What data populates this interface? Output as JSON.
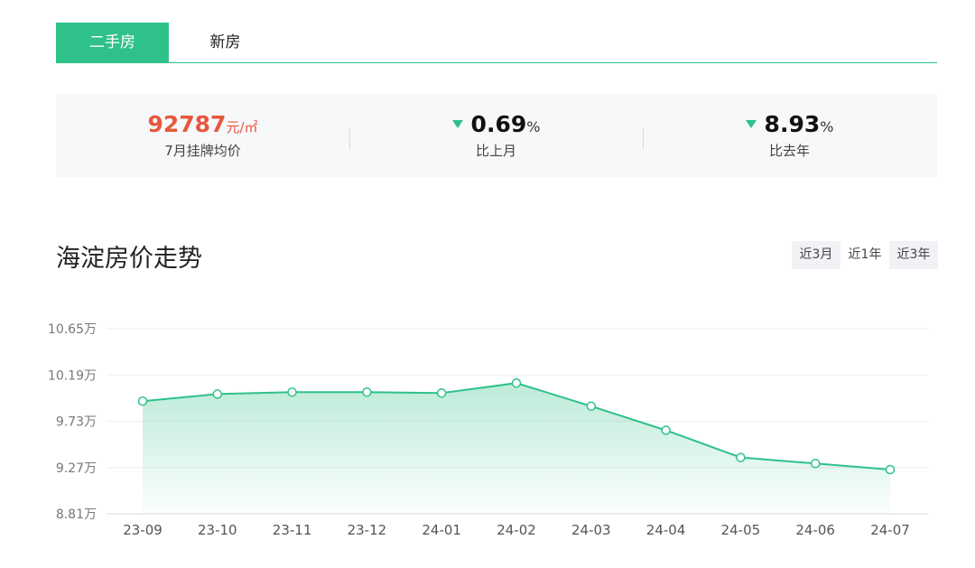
{
  "tabs": [
    {
      "label": "二手房",
      "active": true
    },
    {
      "label": "新房",
      "active": false
    }
  ],
  "stats": {
    "price": {
      "value": "92787",
      "unit": "元/㎡",
      "label": "7月挂牌均价"
    },
    "mom": {
      "value": "0.69",
      "unit": "%",
      "label": "比上月",
      "direction": "down"
    },
    "yoy": {
      "value": "8.93",
      "unit": "%",
      "label": "比去年",
      "direction": "down"
    }
  },
  "section_title": "海淀房价走势",
  "ranges": [
    {
      "label": "近3月",
      "selected": false
    },
    {
      "label": "近1年",
      "selected": true
    },
    {
      "label": "近3年",
      "selected": false
    }
  ],
  "colors": {
    "accent": "#2fc18a",
    "price": "#e8573c"
  },
  "chart_data": {
    "type": "area",
    "categories": [
      "23-09",
      "23-10",
      "23-11",
      "23-12",
      "24-01",
      "24-02",
      "24-03",
      "24-04",
      "24-05",
      "24-06",
      "24-07"
    ],
    "values": [
      9.93,
      10.0,
      10.02,
      10.02,
      10.01,
      10.11,
      9.88,
      9.64,
      9.37,
      9.31,
      9.25
    ],
    "yticks": [
      "10.65万",
      "10.19万",
      "9.73万",
      "9.27万",
      "8.81万"
    ],
    "ytick_values": [
      10.65,
      10.19,
      9.73,
      9.27,
      8.81
    ],
    "ylim": [
      8.81,
      10.65
    ],
    "title": "",
    "xlabel": "",
    "ylabel": "",
    "grid": true
  }
}
